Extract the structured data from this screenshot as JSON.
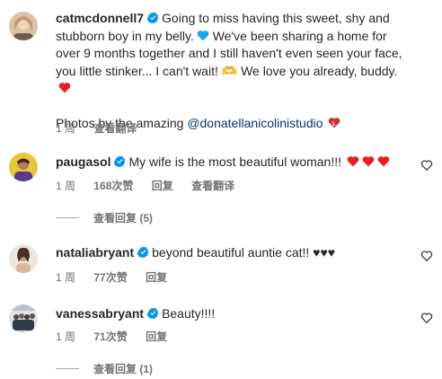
{
  "caption": {
    "username": "catmcdonnell7",
    "text_1": "Going to miss having this sweet, shy and stubborn boy in my belly.",
    "text_2": "We've been sharing a home for over 9 months together and I still haven't even seen your face, you little stinker... I can't wait! 🫶 We love you already, buddy.",
    "photos_prefix": "Photos by the amazing",
    "mention": "@donatellanicolinistudio",
    "time": "1 周",
    "translate": "查看翻译"
  },
  "comments": [
    {
      "username": "paugasol",
      "text": "My wife is the most beautiful woman!!!",
      "time": "1 周",
      "likes": "168次赞",
      "reply": "回复",
      "translate": "查看翻译",
      "view_replies": "查看回复 (5)"
    },
    {
      "username": "nataliabryant",
      "text": "beyond beautiful auntie cat!! ♥♥♥",
      "time": "1 周",
      "likes": "77次赞",
      "reply": "回复"
    },
    {
      "username": "vanessabryant",
      "text": "Beauty!!!!",
      "time": "1 周",
      "likes": "71次赞",
      "reply": "回复",
      "view_replies": "查看回复 (1)"
    }
  ],
  "colors": {
    "verified": "#0095f6",
    "heart_red": "#ed1c24",
    "heart_blue": "#18a8e6",
    "mention": "#00376b",
    "meta": "#737373"
  },
  "icons": {
    "verified": "verified-badge-icon",
    "like": "heart-outline-icon"
  }
}
